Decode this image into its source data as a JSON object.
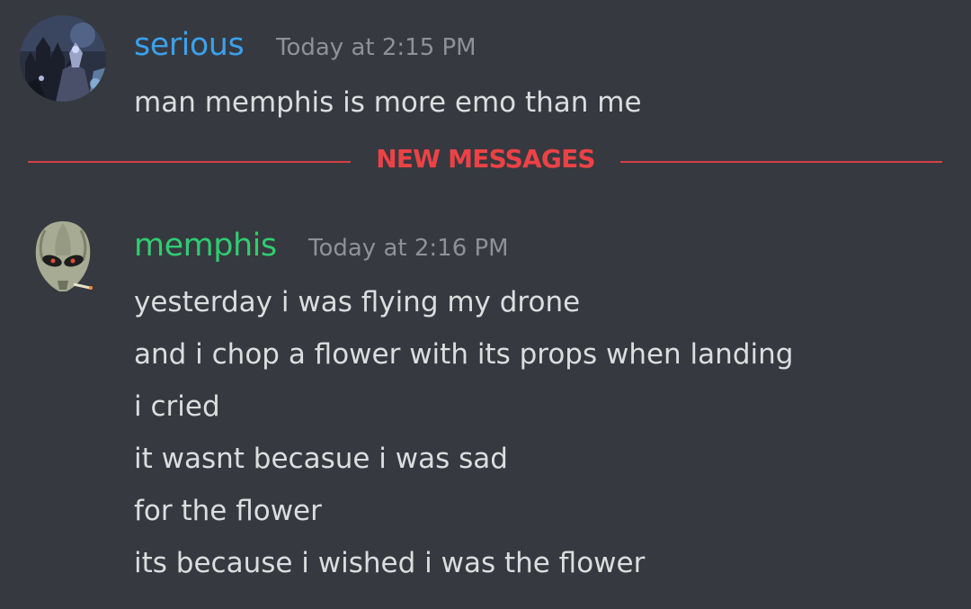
{
  "messages": [
    {
      "author": "serious",
      "author_color": "#3ba0ec",
      "timestamp": "Today at 2:15 PM",
      "avatar_icon": "dark-fantasy-castle-avatar",
      "lines": [
        "man memphis is more emo than me"
      ]
    },
    {
      "author": "memphis",
      "author_color": "#2fcc71",
      "timestamp": "Today at 2:16 PM",
      "avatar_icon": "alien-mask-avatar",
      "lines": [
        "yesterday i was flying my drone",
        "and i chop a flower with its props when landing",
        "i cried",
        "it wasnt becasue i was sad",
        "for the flower",
        "its because i wished i was the flower"
      ]
    }
  ],
  "divider": {
    "label": "NEW MESSAGES",
    "color": "#ed4245"
  }
}
